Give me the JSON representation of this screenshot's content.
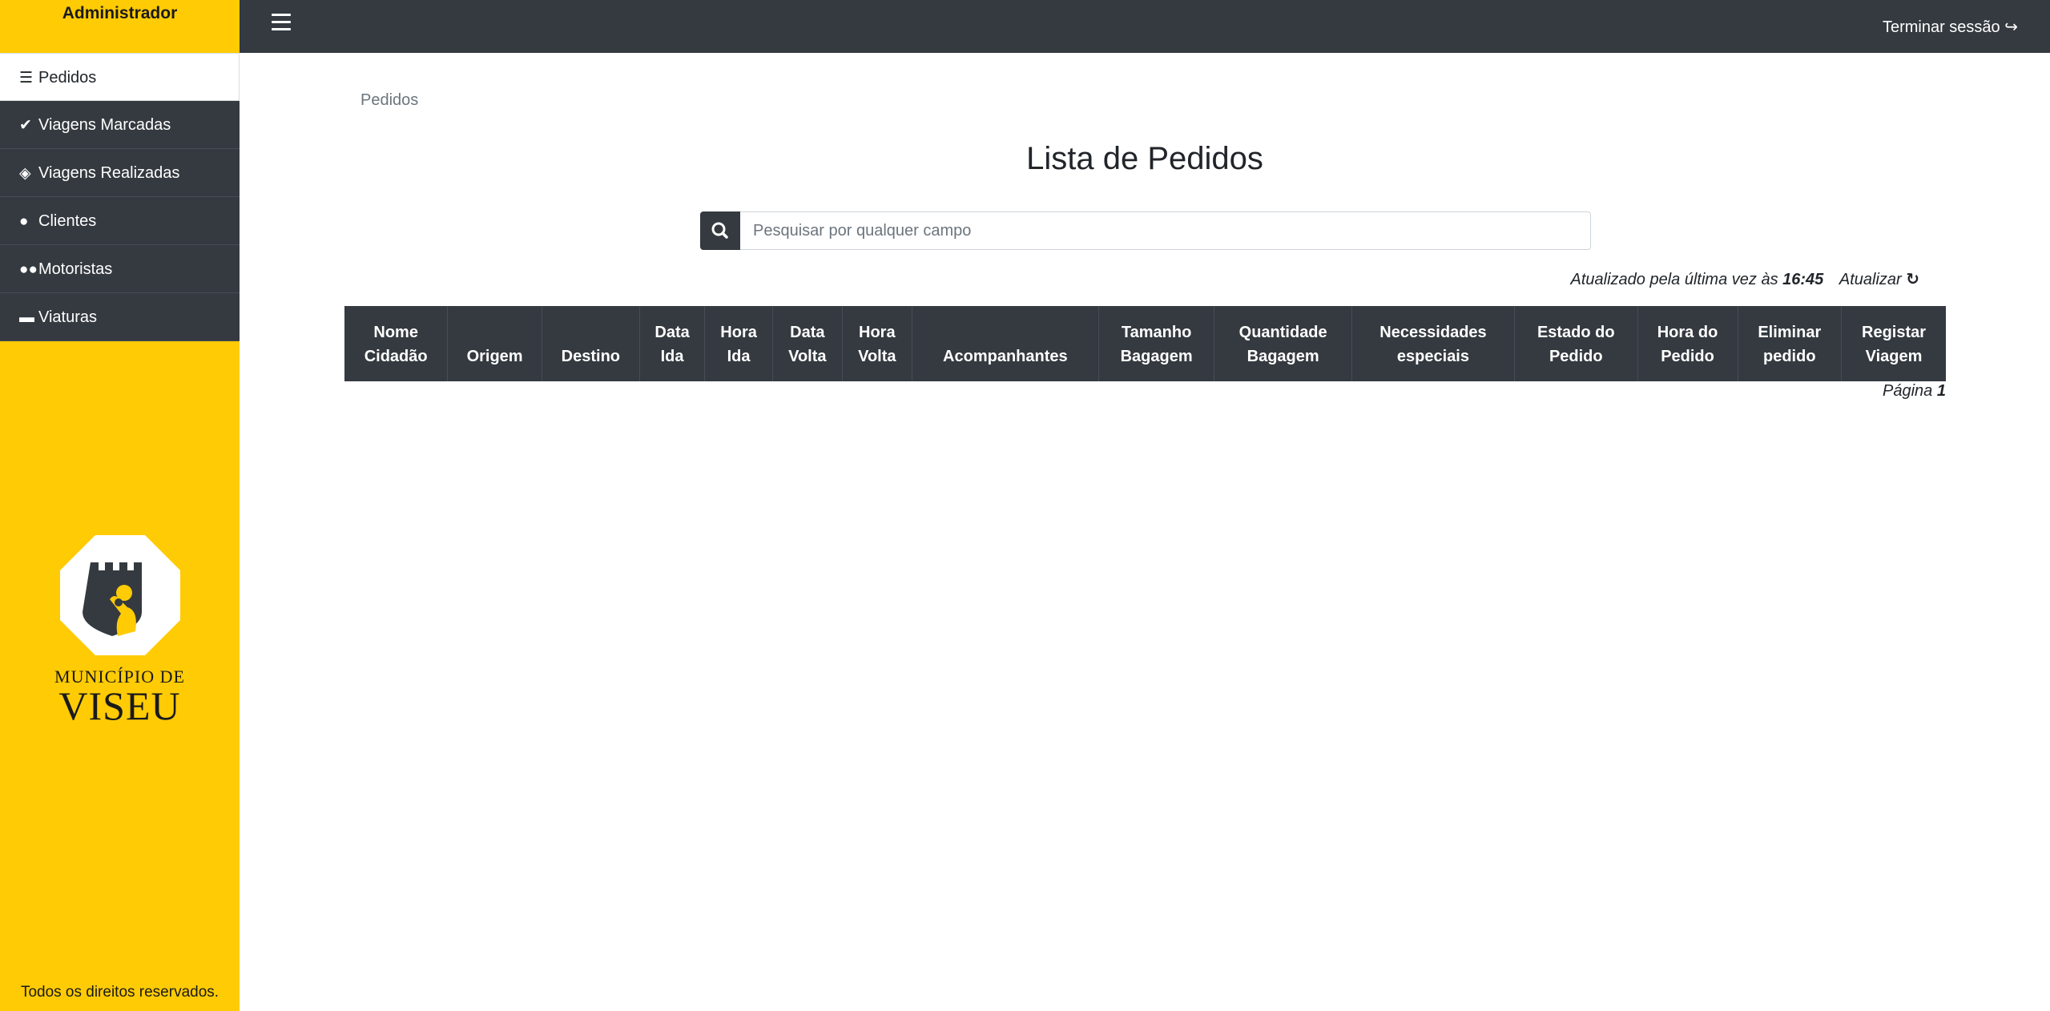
{
  "sidebar": {
    "title": "Administrador",
    "items": [
      {
        "label": "Pedidos",
        "icon": "list-icon"
      },
      {
        "label": "Viagens Marcadas",
        "icon": "check-icon"
      },
      {
        "label": "Viagens Realizadas",
        "icon": "ticket-icon"
      },
      {
        "label": "Clientes",
        "icon": "user-icon"
      },
      {
        "label": "Motoristas",
        "icon": "users-icon"
      },
      {
        "label": "Viaturas",
        "icon": "car-icon"
      }
    ],
    "active_item": "Pedidos",
    "logo": {
      "line1": "MUNICÍPIO DE",
      "line2": "VISEU"
    },
    "footer": "Todos os direitos reservados."
  },
  "topbar": {
    "logout_label": "Terminar sessão"
  },
  "main": {
    "breadcrumb": "Pedidos",
    "title": "Lista de Pedidos",
    "search": {
      "placeholder": "Pesquisar por qualquer campo",
      "value": ""
    },
    "updated_label": "Atualizado pela última vez às",
    "updated_time": "16:45",
    "refresh_label": "Atualizar",
    "table": {
      "columns": [
        [
          "Nome",
          "Cidadão"
        ],
        [
          "Origem"
        ],
        [
          "Destino"
        ],
        [
          "Data",
          "Ida"
        ],
        [
          "Hora",
          "Ida"
        ],
        [
          "Data",
          "Volta"
        ],
        [
          "Hora",
          "Volta"
        ],
        [
          "Acompanhantes"
        ],
        [
          "Tamanho",
          "Bagagem"
        ],
        [
          "Quantidade",
          "Bagagem"
        ],
        [
          "Necessidades",
          "especiais"
        ],
        [
          "Estado do",
          "Pedido"
        ],
        [
          "Hora do",
          "Pedido"
        ],
        [
          "Eliminar",
          "pedido"
        ],
        [
          "Registar",
          "Viagem"
        ]
      ],
      "rows": []
    },
    "page_label": "Página",
    "page_number": "1"
  },
  "colors": {
    "sidebar": "#ffcb05",
    "dark": "#343a40",
    "white": "#ffffff"
  }
}
